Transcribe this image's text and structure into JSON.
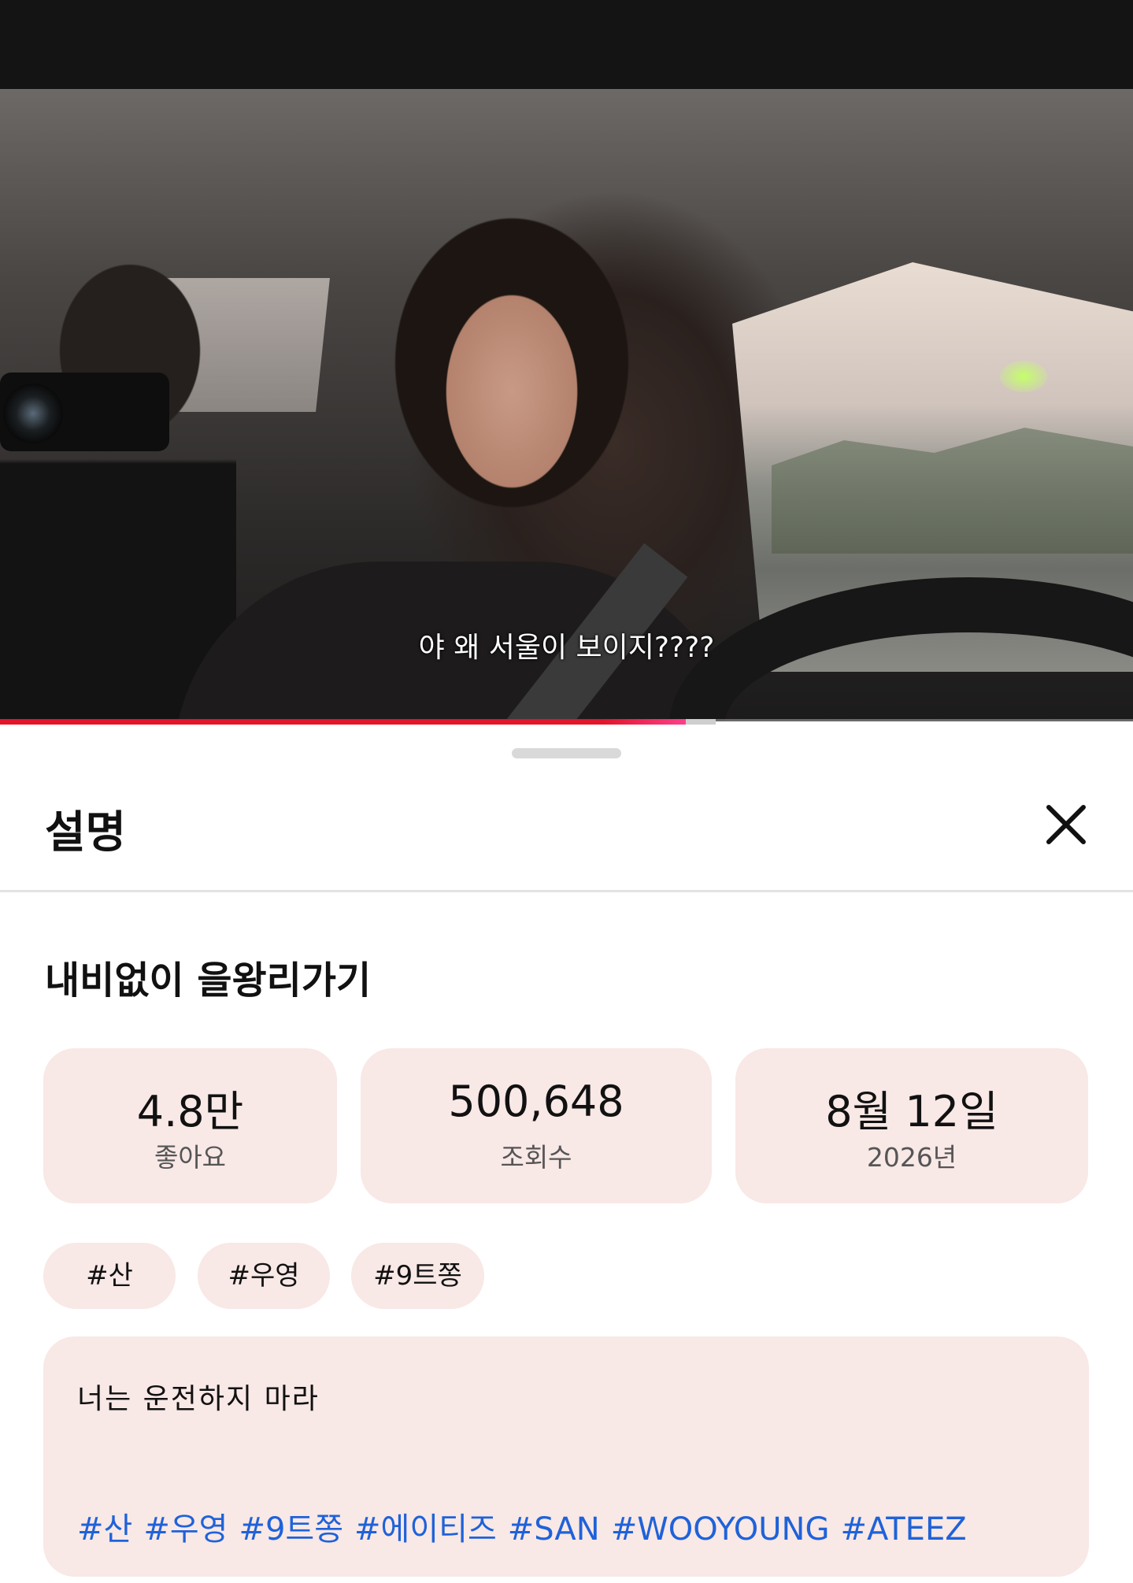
{
  "video": {
    "subtitle": "야 왜 서울이 보이지????",
    "progress_fraction": 0.605,
    "buffer_fraction": 0.632
  },
  "sheet": {
    "title": "설명",
    "close_icon": "close-icon"
  },
  "video_title": "내비없이 을왕리가기",
  "stats": {
    "likes": {
      "value": "4.8만",
      "label": "좋아요"
    },
    "views": {
      "value": "500,648",
      "label": "조회수"
    },
    "date": {
      "value": "8월 12일",
      "label": "2026년"
    }
  },
  "chips": [
    "#산",
    "#우영",
    "#9트쫑"
  ],
  "description": {
    "text": "너는 운전하지 마라",
    "hashtags": [
      "#산",
      "#우영",
      "#9트쫑",
      "#에이티즈",
      "#SAN",
      "#WOOYOUNG",
      "#ATEEZ"
    ]
  },
  "colors": {
    "card_bg": "#f8e8e6",
    "progress": "#e3142b",
    "hashtag": "#1f62d9"
  }
}
